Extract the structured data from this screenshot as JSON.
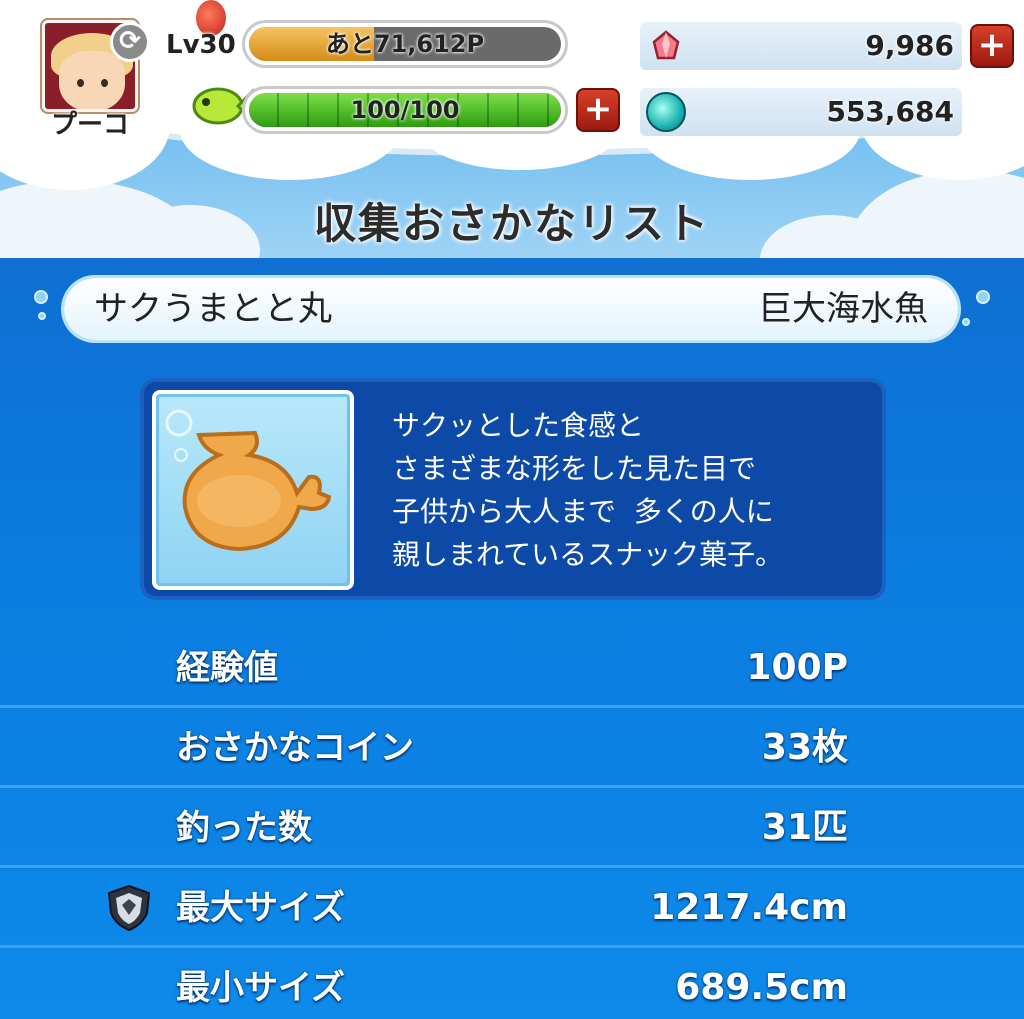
{
  "screen_title": "収集おさかなリスト",
  "player": {
    "name": "プーコ",
    "level_label": "Lv30",
    "exp_label": "あと71,612P",
    "exp_progress": 0.4,
    "stamina_label": "100/100",
    "stamina_progress": 1.0
  },
  "currencies": {
    "gems": "9,986",
    "coins": "553,684"
  },
  "fish": {
    "name": "サクうまとと丸",
    "category": "巨大海水魚",
    "description_lines": [
      "サクッとした食感と",
      "さまざまな形をした見た目で",
      "子供から大人まで  多くの人に",
      "親しまれているスナック菓子。"
    ]
  },
  "stats": [
    {
      "label": "経験値",
      "value": "100P"
    },
    {
      "label": "おさかなコイン",
      "value": "33枚"
    },
    {
      "label": "釣った数",
      "value": "31匹"
    },
    {
      "label": "最大サイズ",
      "value": "1217.4cm"
    },
    {
      "label": "最小サイズ",
      "value": "689.5cm"
    }
  ],
  "icons": {
    "refresh": "refresh-icon",
    "lure": "lure-icon",
    "stamina": "fish-stamina-icon",
    "gem": "gem-icon",
    "coin": "coin-icon",
    "max_size_badge": "shield-icon"
  },
  "colors": {
    "panel_blue": "#0b7cdf",
    "desc_box": "#0d4aa8",
    "exp_fill": "#d48b16",
    "stamina_fill": "#2e9c10",
    "plus_button": "#c0301e"
  }
}
